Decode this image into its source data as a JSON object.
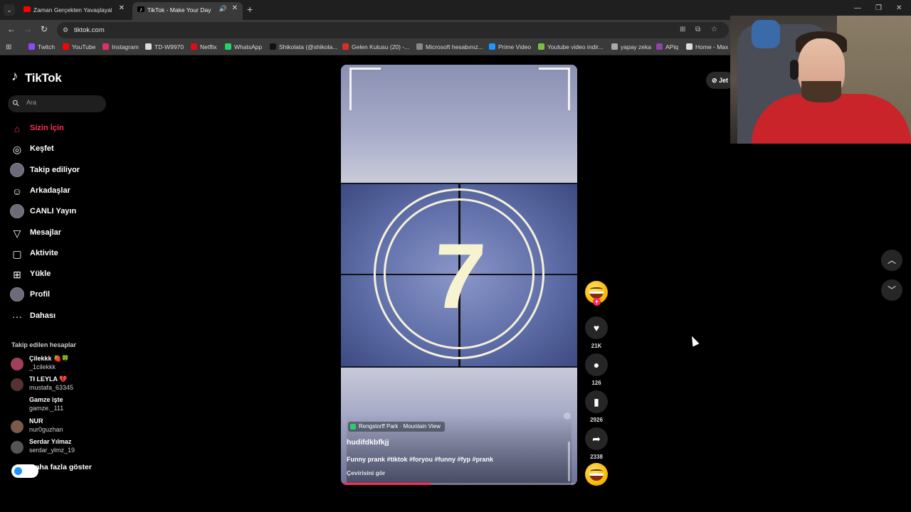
{
  "browser": {
    "tabs": [
      {
        "title": "Zaman Gerçekten Yavaşlayabilir",
        "active": false,
        "favicon": "youtube-icon"
      },
      {
        "title": "TikTok - Make Your Day",
        "active": true,
        "favicon": "tiktok-icon",
        "audio": true
      }
    ],
    "url": "tiktok.com",
    "bookmarks": [
      {
        "label": "Twitch",
        "icon": "twitch-icon",
        "color": "#9146ff"
      },
      {
        "label": "YouTube",
        "icon": "youtube-icon",
        "color": "#ff0000"
      },
      {
        "label": "Instagram",
        "icon": "instagram-icon",
        "color": "#e1306c"
      },
      {
        "label": "TD-W9970",
        "icon": "page-icon",
        "color": "#dddddd"
      },
      {
        "label": "Netflix",
        "icon": "netflix-icon",
        "color": "#e50914"
      },
      {
        "label": "WhatsApp",
        "icon": "whatsapp-icon",
        "color": "#25d366"
      },
      {
        "label": "Shikolata (@shikola...",
        "icon": "tiktok-icon",
        "color": "#111111"
      },
      {
        "label": "Gelen Kutusu (20) -...",
        "icon": "gmail-icon",
        "color": "#d93025"
      },
      {
        "label": "Microsoft hesabınız...",
        "icon": "microsoft-icon",
        "color": "#888888"
      },
      {
        "label": "Prime Video",
        "icon": "prime-video-icon",
        "color": "#1a98ff"
      },
      {
        "label": "Youtube video indir...",
        "icon": "download-icon",
        "color": "#7bc043"
      },
      {
        "label": "yapay zeka",
        "icon": "ai-icon",
        "color": "#aaaaaa"
      },
      {
        "label": "APiq",
        "icon": "apiq-icon",
        "color": "#8e44ad"
      },
      {
        "label": "Home - Max",
        "icon": "max-icon",
        "color": "#dddddd"
      }
    ]
  },
  "sidebar": {
    "logo": "TikTok",
    "search_placeholder": "Ara",
    "nav": [
      {
        "label": "Sizin İçin",
        "icon": "home-icon",
        "active": true
      },
      {
        "label": "Keşfet",
        "icon": "compass-icon"
      },
      {
        "label": "Takip ediliyor",
        "icon": "following-avatar-icon"
      },
      {
        "label": "Arkadaşlar",
        "icon": "friends-icon"
      },
      {
        "label": "CANLI Yayın",
        "icon": "live-avatar-icon"
      },
      {
        "label": "Mesajlar",
        "icon": "send-icon"
      },
      {
        "label": "Aktivite",
        "icon": "activity-icon"
      },
      {
        "label": "Yükle",
        "icon": "upload-icon"
      },
      {
        "label": "Profil",
        "icon": "profile-avatar-icon"
      },
      {
        "label": "Dahası",
        "icon": "more-icon"
      }
    ],
    "following_title": "Takip edilen hesaplar",
    "accounts": [
      {
        "name": "Çilekkk 🍓🍀",
        "handle": "_1cilekkk",
        "avatar_color": "#a0405a"
      },
      {
        "name": "Tł LEYLA 💔",
        "handle": "mustafa_63345",
        "avatar_color": "#553333"
      },
      {
        "name": "Gamze işte",
        "handle": "gamze._111",
        "avatar_color": "#000000"
      },
      {
        "name": "NUR",
        "handle": "nur0guzhan",
        "avatar_color": "#7a5a4a"
      },
      {
        "name": "Serdar Yılmaz",
        "handle": "serdar_ylmz_19",
        "avatar_color": "#555555"
      }
    ],
    "show_more": "Daha fazla göster"
  },
  "video": {
    "countdown": "7",
    "location": "Rengstorff Park · Mountain View",
    "author": "hudifdkbfkjj",
    "caption": "Funny prank #tiktok #foryou #funny #fyp #prank",
    "translate": "Çevirisini gör",
    "progress": 0.38
  },
  "actions": {
    "likes": "21K",
    "comments": "126",
    "saves": "2926",
    "shares": "2338"
  },
  "right": {
    "get_app": "Jet"
  }
}
